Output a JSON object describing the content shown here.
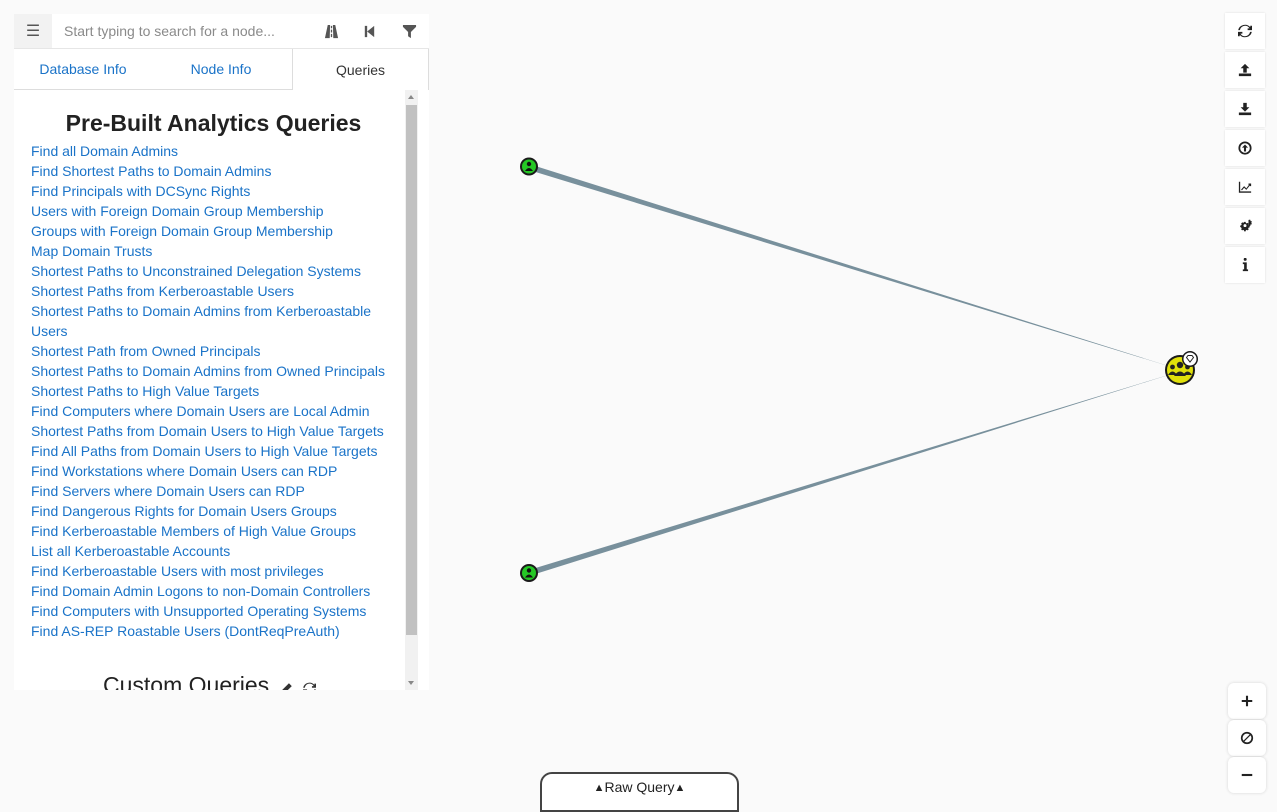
{
  "search": {
    "placeholder": "Start typing to search for a node...",
    "menu_icon": "hamburger-icon",
    "pathfinding_icon": "road-icon",
    "back_icon": "step-backward-icon",
    "filter_icon": "filter-icon"
  },
  "tabs": [
    {
      "label": "Database Info",
      "active": false
    },
    {
      "label": "Node Info",
      "active": false
    },
    {
      "label": "Queries",
      "active": true
    }
  ],
  "queries": {
    "prebuilt_title": "Pre-Built Analytics Queries",
    "items": [
      "Find all Domain Admins",
      "Find Shortest Paths to Domain Admins",
      "Find Principals with DCSync Rights",
      "Users with Foreign Domain Group Membership",
      "Groups with Foreign Domain Group Membership",
      "Map Domain Trusts",
      "Shortest Paths to Unconstrained Delegation Systems",
      "Shortest Paths from Kerberoastable Users",
      "Shortest Paths to Domain Admins from Kerberoastable Users",
      "Shortest Path from Owned Principals",
      "Shortest Paths to Domain Admins from Owned Principals",
      "Shortest Paths to High Value Targets",
      "Find Computers where Domain Users are Local Admin",
      "Shortest Paths from Domain Users to High Value Targets",
      "Find All Paths from Domain Users to High Value Targets",
      "Find Workstations where Domain Users can RDP",
      "Find Servers where Domain Users can RDP",
      "Find Dangerous Rights for Domain Users Groups",
      "Find Kerberoastable Members of High Value Groups",
      "List all Kerberoastable Accounts",
      "Find Kerberoastable Users with most privileges",
      "Find Domain Admin Logons to non-Domain Controllers",
      "Find Computers with Unsupported Operating Systems",
      "Find AS-REP Roastable Users (DontReqPreAuth)"
    ],
    "custom_title": "Custom Queries",
    "custom_icons": [
      "pencil-icon",
      "refresh-icon"
    ]
  },
  "toolbar": {
    "buttons": [
      "refresh-icon",
      "upload-icon",
      "download-icon",
      "import-icon",
      "graph-stats-icon",
      "settings-icon",
      "info-icon"
    ]
  },
  "zoom": {
    "buttons": [
      "zoom-in-icon",
      "reset-zoom-icon",
      "zoom-out-icon"
    ]
  },
  "raw_query": {
    "label": "Raw Query",
    "icon": "caret-up-icon"
  },
  "graph": {
    "nodes": [
      {
        "type": "user",
        "color": "#20c020",
        "icon": "user-icon"
      },
      {
        "type": "user",
        "color": "#20c020",
        "icon": "user-icon"
      },
      {
        "type": "group",
        "color": "#d4d40a",
        "icon": "group-icon",
        "badge": "high-value-gem-icon"
      }
    ],
    "edge_color": "#78909c"
  }
}
